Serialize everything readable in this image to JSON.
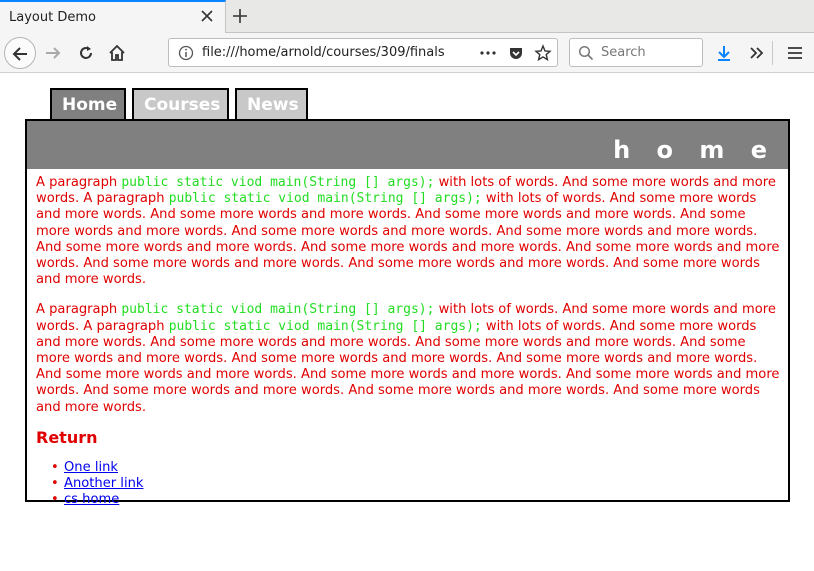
{
  "browser": {
    "tab_title": "Layout Demo",
    "url": "file:///home/arnold/courses/309/finals",
    "search_placeholder": "Search",
    "accent_color": "#0a84ff"
  },
  "page": {
    "tabs": [
      {
        "label": "Home",
        "active": true
      },
      {
        "label": "Courses",
        "active": false
      },
      {
        "label": "News",
        "active": false
      }
    ],
    "banner": "h o m e",
    "paragraphs": [
      {
        "s1": "A paragraph ",
        "c1": "public static viod main(String [] args);",
        "s2": " with lots of words. And some more words and more words. A paragraph ",
        "c2": "public static viod main(String [] args);",
        "s3": " with lots of words. And some more words and more words. And some more words and more words. And some more words and more words. And some more words and more words. And some more words and more words. And some more words and more words. And some more words and more words. And some more words and more words. And some more words and more words. And some more words and more words. And some more words and more words. And some more words and more words."
      },
      {
        "s1": "A paragraph ",
        "c1": "public static viod main(String [] args);",
        "s2": " with lots of words. And some more words and more words. A paragraph ",
        "c2": "public static viod main(String [] args);",
        "s3": " with lots of words. And some more words and more words. And some more words and more words. And some more words and more words. And some more words and more words. And some more words and more words. And some more words and more words. And some more words and more words. And some more words and more words. And some more words and more words. And some more words and more words. And some more words and more words. And some more words and more words."
      }
    ],
    "return_heading": "Return",
    "links": [
      "One link",
      "Another link",
      "cs home"
    ],
    "colors": {
      "text": "#e00000",
      "code": "#22dd22",
      "banner_bg": "#808080",
      "link": "#0000ee"
    }
  }
}
